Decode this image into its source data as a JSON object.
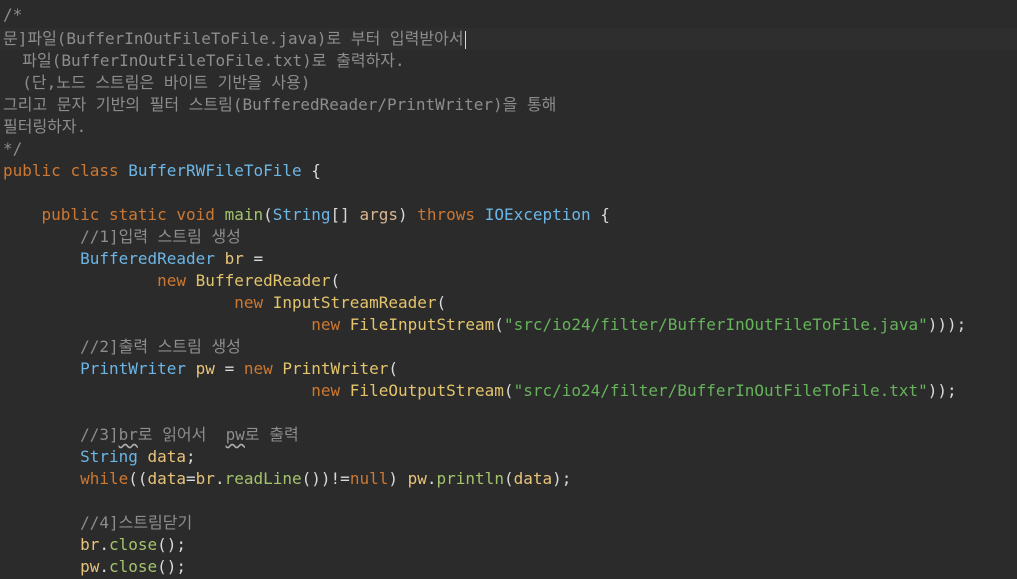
{
  "editor": {
    "comment": {
      "l1": "/*",
      "l2": "문]파일(BufferInOutFileToFile.java)로 부터 입력받아서",
      "l3": "  파일(BufferInOutFileToFile.txt)로 출력하자.",
      "l4": "  (단,노드 스트림은 바이트 기반을 사용)",
      "l5": "그리고 문자 기반의 필터 스트림(BufferedReader/PrintWriter)을 통해",
      "l6": "필터링하자.",
      "l7": "*/"
    },
    "class_decl": {
      "kw_public": "public",
      "kw_class": "class",
      "name": "BufferRWFileToFile",
      "brace": " {"
    },
    "main_decl": {
      "kw_public": "public",
      "kw_static": "static",
      "kw_void": "void",
      "name": "main",
      "open": "(",
      "param_type": "String",
      "brackets": "[]",
      "param_name": "args",
      "close": ")",
      "kw_throws": "throws",
      "exception": "IOException",
      "brace": " {"
    },
    "c1": "//1]입력 스트림 생성",
    "br_decl": {
      "type": "BufferedReader",
      "var": "br",
      "eq": " ="
    },
    "new_br": {
      "kw": "new",
      "type": "BufferedReader",
      "paren": "("
    },
    "new_isr": {
      "kw": "new",
      "type": "InputStreamReader",
      "paren": "("
    },
    "new_fis": {
      "kw": "new",
      "type": "FileInputStream",
      "open": "(",
      "str": "\"src/io24/filter/BufferInOutFileToFile.java\"",
      "close": ")));"
    },
    "c2": "//2]출력 스트림 생성",
    "pw_decl": {
      "type": "PrintWriter",
      "var": "pw",
      "eq": " = ",
      "kw": "new",
      "type2": "PrintWriter",
      "paren": "("
    },
    "new_fos": {
      "kw": "new",
      "type": "FileOutputStream",
      "open": "(",
      "str": "\"src/io24/filter/BufferInOutFileToFile.txt\"",
      "close": "));"
    },
    "c3": {
      "prefix": "//3]",
      "br": "br",
      "mid": "로 읽어서  ",
      "pw": "pw",
      "suffix": "로 출력"
    },
    "data_decl": {
      "type": "String",
      "var": "data",
      "semi": ";"
    },
    "while_line": {
      "kw": "while",
      "p1": "((",
      "var1": "data",
      "eq": "=",
      "obj": "br",
      "dot": ".",
      "method": "readLine",
      "p2": "())!=",
      "kw_null": "null",
      "p3": ") ",
      "obj2": "pw",
      "dot2": ".",
      "method2": "println",
      "p4": "(",
      "var2": "data",
      "p5": ");"
    },
    "c4": "//4]스트림닫기",
    "br_close": {
      "obj": "br",
      "dot": ".",
      "method": "close",
      "tail": "();"
    },
    "pw_close": {
      "obj": "pw",
      "dot": ".",
      "method": "close",
      "tail": "();"
    }
  }
}
